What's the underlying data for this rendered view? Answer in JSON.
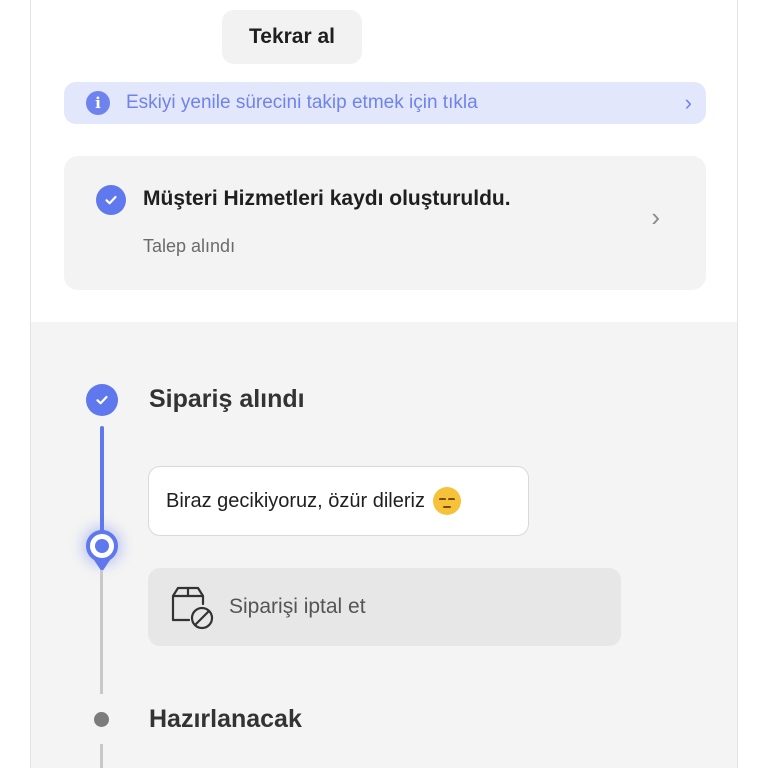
{
  "retry_button": {
    "label": "Tekrar al"
  },
  "info_banner": {
    "icon": "info-icon",
    "text": "Eskiyi yenile sürecini takip etmek için tıkla",
    "chevron": "›"
  },
  "status_card": {
    "icon": "check-circle-icon",
    "title": "Müşteri Hizmetleri kaydı oluşturuldu.",
    "subtitle": "Talep alındı",
    "chevron": "›"
  },
  "timeline": {
    "steps": [
      {
        "title": "Sipariş alındı",
        "state": "done"
      },
      {
        "title": "Hazırlanacak",
        "state": "pending"
      }
    ],
    "delay_message": "Biraz gecikiyoruz, özür dileriz",
    "delay_emoji": "pensive-face-icon",
    "cancel_button": {
      "icon": "package-cancel-icon",
      "label": "Siparişi iptal et"
    }
  },
  "colors": {
    "accent": "#5f78ee",
    "banner_bg": "#e3e7fb",
    "card_bg": "#f3f3f3",
    "timeline_bg": "#f4f4f4"
  }
}
